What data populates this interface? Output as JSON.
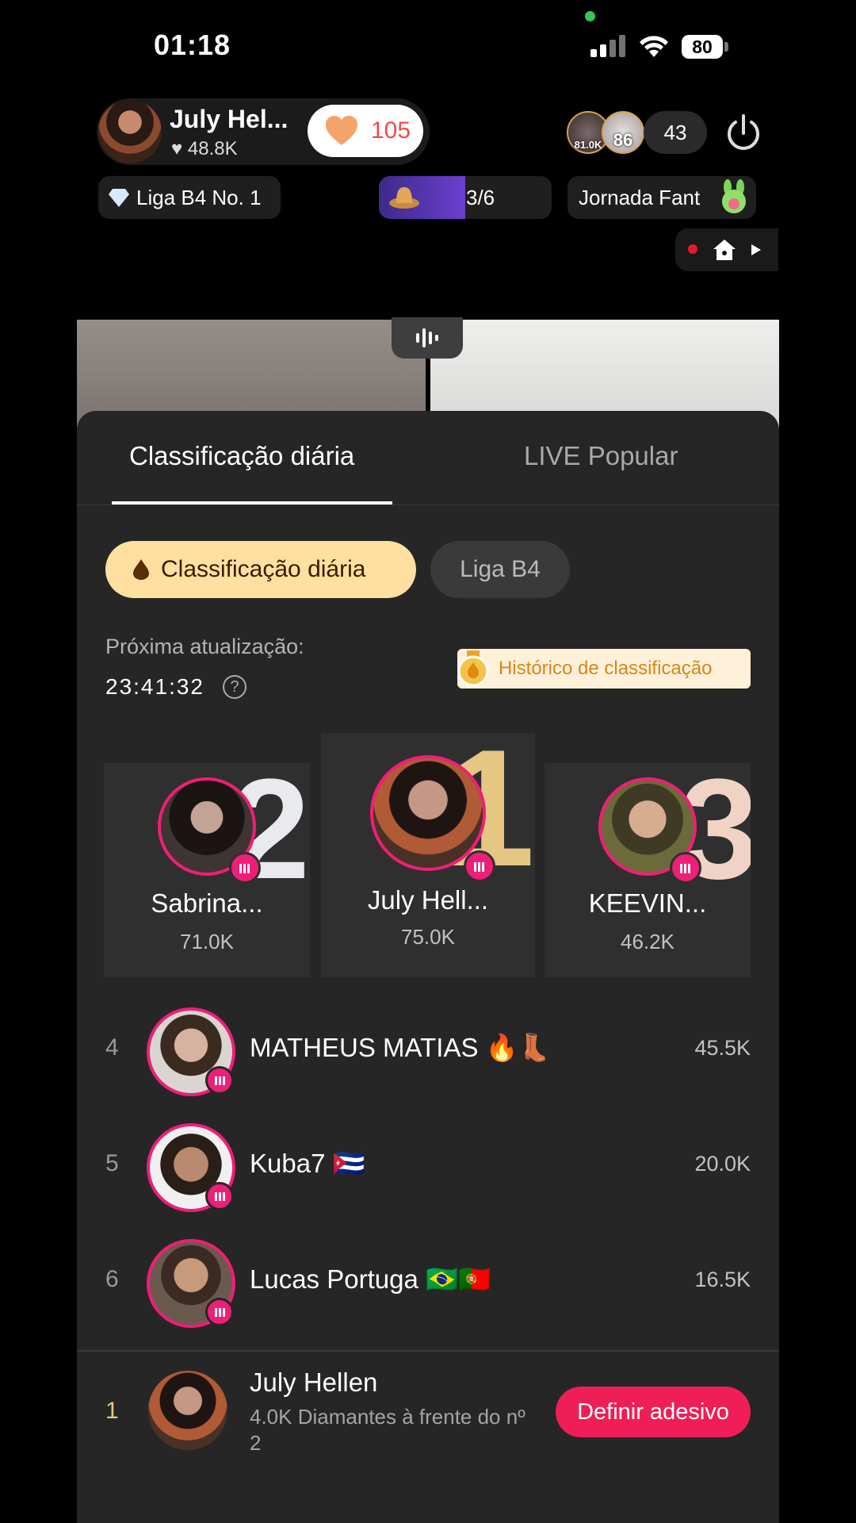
{
  "status_bar": {
    "time": "01:18",
    "battery": "80"
  },
  "live_header": {
    "host_name": "July Hel...",
    "host_likes": "48.8K",
    "like_count": "105",
    "viewer_badges": [
      "81.0K",
      "86"
    ],
    "viewer_count": "43",
    "league_chip": "Liga B4 No. 1",
    "progress_text": "3/6",
    "progress_fraction": 0.5,
    "journey_chip": "Jornada Fant"
  },
  "sheet": {
    "tabs": [
      {
        "label": "Classificação diária",
        "active": true
      },
      {
        "label": "LIVE Popular",
        "active": false
      }
    ],
    "segments": [
      {
        "label": "Classificação diária",
        "active": true
      },
      {
        "label": "Liga B4",
        "active": false
      }
    ],
    "next_update_label": "Próxima atualização:",
    "next_update_time": "23:41:32",
    "help_icon": "?",
    "history_button": "Histórico de classificação",
    "podium": [
      {
        "rank": "2",
        "name": "Sabrina...",
        "score": "71.0K"
      },
      {
        "rank": "1",
        "name": "July Hell...",
        "score": "75.0K"
      },
      {
        "rank": "3",
        "name": "KEEVIN...",
        "score": "46.2K"
      }
    ],
    "list": [
      {
        "rank": "4",
        "name": "MATHEUS MATIAS 🔥👢",
        "score": "45.5K"
      },
      {
        "rank": "5",
        "name": "Kuba7 🇨🇺",
        "score": "20.0K"
      },
      {
        "rank": "6",
        "name": "Lucas Portuga 🇧🇷🇵🇹",
        "score": "16.5K"
      }
    ],
    "self": {
      "rank": "1",
      "name": "July Hellen",
      "subtitle": "4.0K Diamantes à frente do nº 2",
      "button": "Definir adesivo"
    }
  },
  "colors": {
    "accent_pink": "#ef1e77",
    "sticker_button": "#ef1e56",
    "gold": "#e5c683",
    "segment_active_bg": "#ffe0a0"
  }
}
